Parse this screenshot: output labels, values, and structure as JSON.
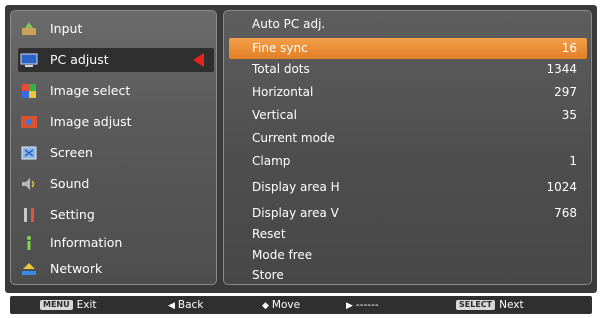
{
  "menu": {
    "items": [
      {
        "label": "Input",
        "icon": "input-icon"
      },
      {
        "label": "PC adjust",
        "icon": "pc-adjust-icon"
      },
      {
        "label": "Image select",
        "icon": "image-select-icon"
      },
      {
        "label": "Image adjust",
        "icon": "image-adjust-icon"
      },
      {
        "label": "Screen",
        "icon": "screen-icon"
      },
      {
        "label": "Sound",
        "icon": "sound-icon"
      },
      {
        "label": "Setting",
        "icon": "setting-icon"
      },
      {
        "label": "Information",
        "icon": "information-icon"
      },
      {
        "label": "Network",
        "icon": "network-icon"
      }
    ],
    "active_index": 1
  },
  "submenu": {
    "rows": [
      {
        "label": "Auto PC adj.",
        "value": ""
      },
      {
        "label": "Fine sync",
        "value": "16"
      },
      {
        "label": "Total dots",
        "value": "1344"
      },
      {
        "label": "Horizontal",
        "value": "297"
      },
      {
        "label": "Vertical",
        "value": "35"
      },
      {
        "label": "Current mode",
        "value": ""
      },
      {
        "label": "Clamp",
        "value": "1"
      },
      {
        "label": "Display area H",
        "value": "1024"
      },
      {
        "label": "Display area V",
        "value": "768"
      },
      {
        "label": "Reset",
        "value": ""
      },
      {
        "label": "Mode free",
        "value": ""
      },
      {
        "label": "Store",
        "value": ""
      }
    ],
    "selected_index": 1
  },
  "footer": {
    "exit_key": "MENU",
    "exit_label": "Exit",
    "back_glyph": "◀",
    "back_label": "Back",
    "move_glyph": "◆",
    "move_label": "Move",
    "forward_glyph": "▶",
    "forward_label": "------",
    "next_key": "SELECT",
    "next_label": "Next"
  },
  "colors": {
    "selection": "#e8862f",
    "pointer_arrow": "#e8231d",
    "panel": "#555555"
  }
}
